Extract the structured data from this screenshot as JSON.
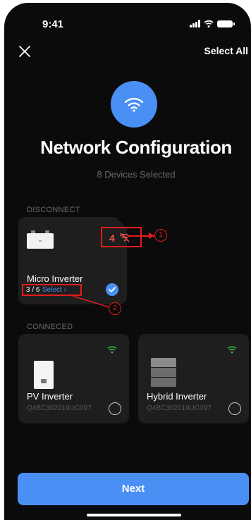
{
  "status_bar": {
    "time": "9:41"
  },
  "header": {
    "select_all_label": "Select All"
  },
  "hero": {
    "icon": "wifi-icon",
    "title": "Network Configuration",
    "subtitle": "8 Devices Selected"
  },
  "sections": {
    "disconnected_label": "DISCONNECT",
    "connected_label": "CONNECED"
  },
  "disconnected_devices": [
    {
      "name": "Micro Inverter",
      "offline_count": "4",
      "offline_icon": "wifi-off-icon",
      "count_text": "3 / 6",
      "select_label": "Select ›",
      "selected": true
    }
  ],
  "connected_devices": [
    {
      "name": "PV Inverter",
      "serial": "Q4BC302019UC097",
      "icon": "wifi-icon",
      "selected": false
    },
    {
      "name": "Hybrid Inverter",
      "serial": "Q4BC302019UC097",
      "icon": "wifi-icon",
      "selected": false
    }
  ],
  "annotations": [
    "1",
    "2"
  ],
  "footer": {
    "next_label": "Next"
  },
  "colors": {
    "accent": "#4a8ff4",
    "connected": "#2ecc40",
    "annotation": "#e31b1b",
    "background": "#0b0b0b",
    "card": "#1e1e1e"
  }
}
